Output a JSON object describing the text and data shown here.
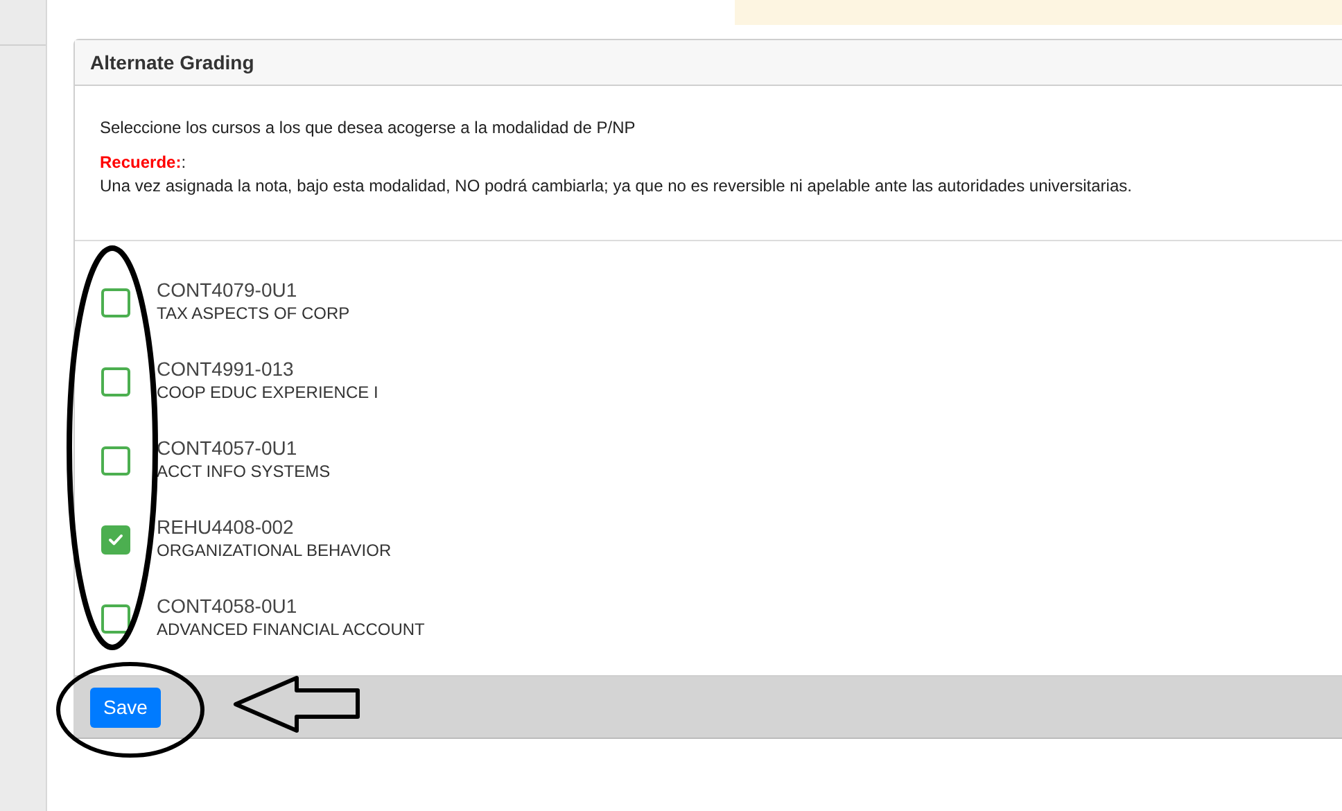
{
  "panel": {
    "title": "Alternate Grading",
    "instruction": "Seleccione los cursos a los que desea acogerse a la modalidad de P/NP",
    "reminder": "**Recuerde:**:",
    "warning": "Una vez asignada la nota, bajo esta modalidad, NO podrá cambiarla; ya que no es reversible ni apelable ante las autoridades universitarias."
  },
  "courses": [
    {
      "code": "CONT4079-0U1",
      "name": "TAX ASPECTS OF CORP",
      "checked": false
    },
    {
      "code": "CONT4991-013",
      "name": "COOP EDUC EXPERIENCE I",
      "checked": false
    },
    {
      "code": "CONT4057-0U1",
      "name": "ACCT INFO SYSTEMS",
      "checked": false
    },
    {
      "code": "REHU4408-002",
      "name": "ORGANIZATIONAL BEHAVIOR",
      "checked": true
    },
    {
      "code": "CONT4058-0U1",
      "name": "ADVANCED FINANCIAL ACCOUNT",
      "checked": false
    }
  ],
  "footer": {
    "save_button": "Save"
  }
}
